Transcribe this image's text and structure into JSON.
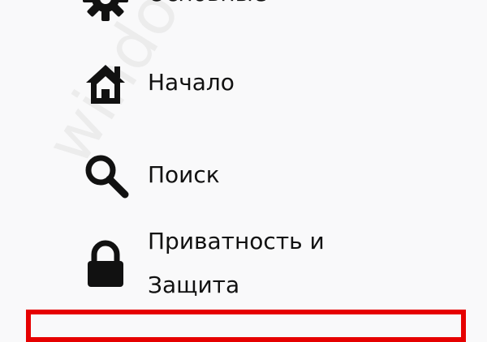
{
  "sidebar": {
    "items": [
      {
        "label": "Основные",
        "icon": "gear-icon"
      },
      {
        "label": "Начало",
        "icon": "home-icon"
      },
      {
        "label": "Поиск",
        "icon": "search-icon"
      },
      {
        "label_line1": "Приватность и",
        "label_line2": "Защита",
        "icon": "lock-icon"
      }
    ]
  },
  "watermark": {
    "text": "windowstips.ru"
  },
  "colors": {
    "background": "#f9f9fa",
    "text": "#111111",
    "highlight": "#e60000"
  }
}
